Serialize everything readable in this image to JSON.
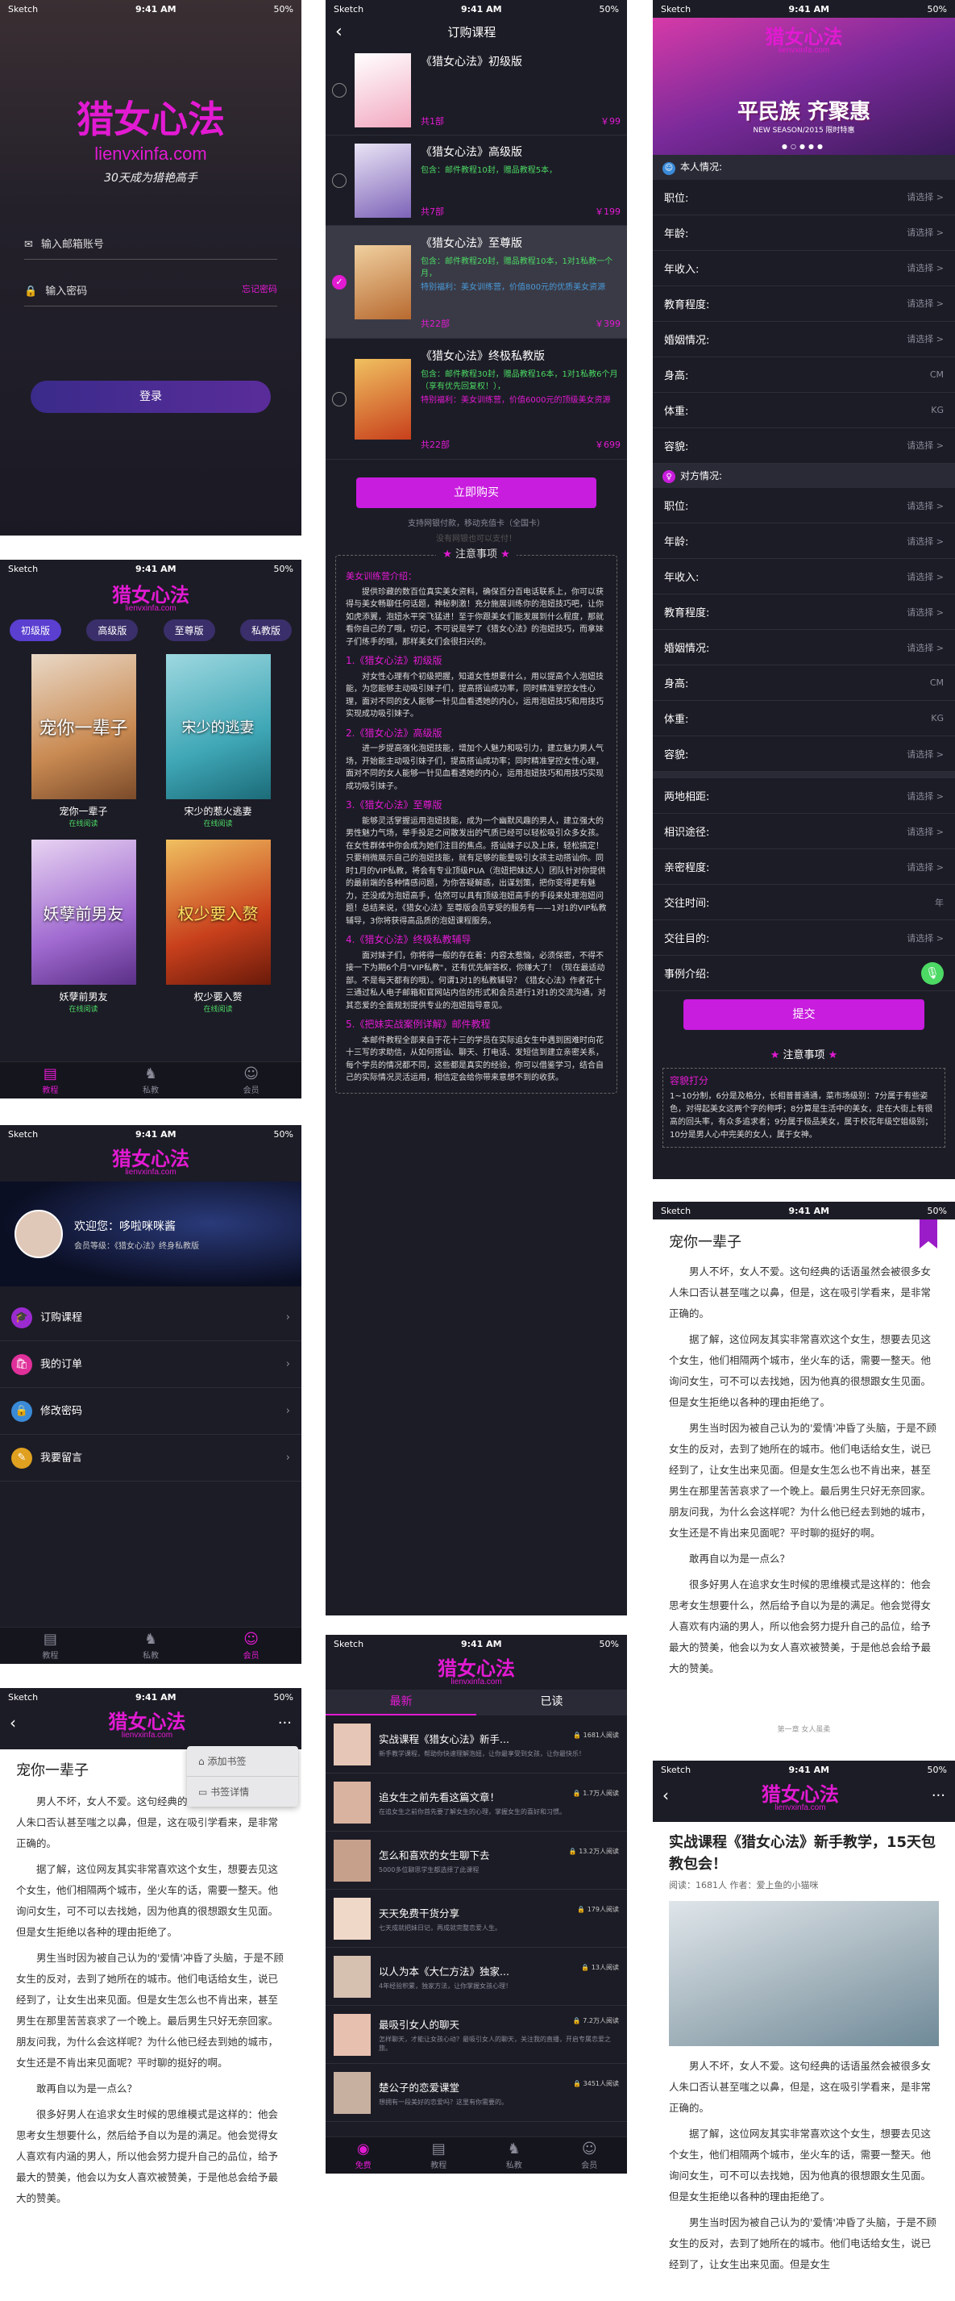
{
  "status": {
    "carrier": "Sketch",
    "time": "9:41 AM",
    "battery": "50%"
  },
  "brand": {
    "name": "猎女心法",
    "domain": "lienvxinfa.com",
    "slogan": "30天成为猎艳高手"
  },
  "login": {
    "email_ph": "输入邮箱账号",
    "pwd_ph": "输入密码",
    "forgot": "忘记密码",
    "submit": "登录"
  },
  "shelf": {
    "tabs": [
      "初级版",
      "高级版",
      "至尊版",
      "私教版"
    ],
    "books": [
      {
        "cover": "宠你一辈子",
        "title": "宠你一辈子",
        "status": "在线阅读"
      },
      {
        "cover": "宋少的逃妻",
        "title": "宋少的惹火逃妻",
        "status": "在线阅读"
      },
      {
        "cover": "妖孽前男友",
        "title": "妖孽前男友",
        "status": "在线阅读"
      },
      {
        "cover": "权少要入赘",
        "title": "权少要入赘",
        "status": "在线阅读"
      }
    ]
  },
  "nav": {
    "tutorial": "教程",
    "private": "私教",
    "member": "会员",
    "free": "免费"
  },
  "profile": {
    "welcome": "欢迎您：哆啦咪咪酱",
    "level": "会员等级：《猎女心法》终身私教版",
    "menu": [
      "订购课程",
      "我的订单",
      "修改密码",
      "我要留言"
    ]
  },
  "order": {
    "title": "订购课程",
    "items": [
      {
        "name": "《猎女心法》初级版",
        "desc": "",
        "extra": "",
        "count": "共1部",
        "price": "￥99"
      },
      {
        "name": "《猎女心法》高级版",
        "desc": "包含：邮件教程10封，赠品教程5本，",
        "extra": "",
        "count": "共7部",
        "price": "￥199"
      },
      {
        "name": "《猎女心法》至尊版",
        "desc": "包含：邮件教程20封，赠品教程10本，1对1私教一个月，",
        "extra": "特别福利：美女训练营，价值800元的优质美女资源",
        "count": "共22部",
        "price": "￥399"
      },
      {
        "name": "《猎女心法》终极私教版",
        "desc": "包含：邮件教程30封，赠品教程16本，1对1私教6个月（享有优先回复权！），",
        "extra": "特别福利：美女训练营，价值6000元的顶级美女资源",
        "count": "共22部",
        "price": "￥699"
      }
    ],
    "buy": "立即购买",
    "pay1": "支持网银付款，移动充值卡（全国卡）",
    "pay2": "没有网银也可以支付！",
    "notice_title": "注意事项"
  },
  "notice": {
    "s0": "美女训练营介绍：",
    "p0": "提供珍藏的数百位真实美女资料，确保百分百电话联系上，你可以获得与美女畅聊任何话题，神秘刺激！充分施展训练你的泡妞技巧吧，让你如虎添翼，泡妞水平突飞猛进！至于你跟美女们能发展到什么程度，那就看你自己的了哦，切记，不可说是学了《猎女心法》的泡妞技巧，而拿妹子们练手的哦，那样美女们会很扫兴的。",
    "s1": "1.《猎女心法》初级版",
    "p1": "对女性心理有个初级把握，知道女性想要什么，用以提高个人泡妞技能，为您能够主动吸引妹子们，提高搭讪成功率，同时精准掌控女性心理，面对不同的女人能够一针见血看透她的内心，运用泡妞技巧和用技巧实现成功吸引妹子。",
    "s2": "2.《猎女心法》高级版",
    "p2": "进一步提高强化泡妞技能，增加个人魅力和吸引力，建立魅力男人气场，开始能主动吸引妹子们，提高搭讪成功率；同时精准掌控女性心理，面对不同的女人能够一针见血看透她的内心，运用泡妞技巧和用技巧实现成功吸引妹子。",
    "s3": "3.《猎女心法》至尊版",
    "p3": "能够灵活掌握运用泡妞技能，成为一个幽默风趣的男人，建立强大的男性魅力气场，举手投足之间散发出的气质已经可以轻松吸引众多女孩。在女性群体中你会成为她们注目的焦点。搭讪妹子以及上床，轻松搞定！只要稍微展示自己的泡妞技能，就有足够的能量吸引女孩主动搭讪你。同时1月的VIP私教，将会有专业顶级PUA（泡妞把妹达人）团队针对你提供的最前端的各种情感问题，为你答疑解惑，出谋划策，把你变得更有魅力，还没成为泡妞高手，估然可以具有顶级泡妞高手的手段来处理泡妞问题！总结来说，《猎女心法》至尊版会员享受的服务有——1对1的VIP私教辅导，3你将获得高品质的泡妞课程服务。",
    "s4": "4.《猎女心法》终极私教辅导",
    "p4": "面对妹子们，你将得一般的存在着：内容太惹恼，必须保密，不得不接一下为期6个月\"VIP私教\"，还有优先解答权，你赚大了！（现在最适动部。不是每天都有的哦）。何谓1对1的私教辅导？《猎女心法》作者花十三通过私人电子邮箱和官网站内信的形式和会员进行1对1的交流沟通，对其恋爱的全面规划提供专业的泡妞指导意见。",
    "s5": "5.《把妹实战案例详解》邮件教程",
    "p5": "本邮件教程全部来自于花十三的学员在实际追女生中遇到困难时向花十三写的求助信，从如何搭讪、聊天、打电话、发短信到建立亲密关系，每个学员的情况都不同，这些都是真实的经验，你可以借鉴学习，结合自己的实际情况灵活运用，相信定会给你带来意想不到的收获。"
  },
  "questionnaire": {
    "banner_big": "平民族 齐聚惠",
    "banner_small": "NEW SEASON/2015 限时特惠",
    "section1": "本人情况:",
    "section2": "对方情况:",
    "self_fields": [
      {
        "label": "职位:",
        "value": "请选择 >"
      },
      {
        "label": "年龄:",
        "value": "请选择 >"
      },
      {
        "label": "年收入:",
        "value": "请选择 >"
      },
      {
        "label": "教育程度:",
        "value": "请选择 >"
      },
      {
        "label": "婚姻情况:",
        "value": "请选择 >"
      },
      {
        "label": "身高:",
        "value": "CM"
      },
      {
        "label": "体重:",
        "value": "KG"
      },
      {
        "label": "容貌:",
        "value": "请选择 >"
      }
    ],
    "other_fields": [
      {
        "label": "职位:",
        "value": "请选择 >"
      },
      {
        "label": "年龄:",
        "value": "请选择 >"
      },
      {
        "label": "年收入:",
        "value": "请选择 >"
      },
      {
        "label": "教育程度:",
        "value": "请选择 >"
      },
      {
        "label": "婚姻情况:",
        "value": "请选择 >"
      },
      {
        "label": "身高:",
        "value": "CM"
      },
      {
        "label": "体重:",
        "value": "KG"
      },
      {
        "label": "容貌:",
        "value": "请选择 >"
      }
    ],
    "extra_fields": [
      {
        "label": "两地相距:",
        "value": "请选择 >"
      },
      {
        "label": "相识途径:",
        "value": "请选择 >"
      },
      {
        "label": "亲密程度:",
        "value": "请选择 >"
      },
      {
        "label": "交往时间:",
        "value": "年"
      },
      {
        "label": "交往目的:",
        "value": "请选择 >"
      }
    ],
    "example": "事例介绍:",
    "submit": "提交",
    "notice_title": "注意事项",
    "notice_tag": "容貌打分",
    "notice_text": "1~10分制，6分是及格分，长相普普通通，菜市场级别：7分属于有些姿色，对得起美女这两个字的称呼；8分算是生活中的美女，走在大街上有很高的回头率，有众多追求者；9分属于极品美女，属于校花年级空姐级别；10分是男人心中完美的女人，属于女神。"
  },
  "reader": {
    "title": "宠你一辈子",
    "footer": "第一章 女人虽柔",
    "paras": [
      "男人不坏，女人不爱。这句经典的话语虽然会被很多女人朱口否认甚至嗤之以鼻，但是，这在吸引学看来，是非常正确的。",
      "据了解，这位网友其实非常喜欢这个女生，想要去见这个女生，他们相隔两个城市，坐火车的话，需要一整天。他询问女生，可不可以去找她，因为他真的很想跟女生见面。但是女生拒绝以各种的理由拒绝了。",
      "男生当时因为被自己认为的'爱情'冲昏了头脑，于是不顾女生的反对，去到了她所在的城市。他们电话给女生，说已经到了，让女生出来见面。但是女生怎么也不肯出来，甚至男生在那里苦苦哀求了一个晚上。最后男生只好无奈回家。朋友问我，为什么会这样呢？为什么他已经去到她的城市，女生还是不肯出来见面呢？平时聊的挺好的啊。",
      "敢再自以为是一点么？",
      "很多好男人在追求女生时候的思维模式是这样的：他会思考女生想要什么，然后给予自以为是的满足。他会觉得女人喜欢有内涵的男人，所以他会努力提升自己的品位，给予最大的赞美，他会以为女人喜欢被赞美，于是他总会给予最大的赞美。"
    ]
  },
  "reader2": {
    "bookmark": "添加书签",
    "detail": "书签详情"
  },
  "list": {
    "tabs": [
      "最新",
      "已读"
    ],
    "items": [
      {
        "title": "实战课程《猎女心法》新手...",
        "desc": "新手教学课程，帮助你快速理解泡妞，让你最享受到女孩，让你最快乐！",
        "reads": "1681人阅读"
      },
      {
        "title": "追女生之前先看这篇文章！",
        "desc": "在追女生之前你首先要了解女生的心理，掌握女生的喜好和习惯。",
        "reads": "1.7万人阅读"
      },
      {
        "title": "怎么和喜欢的女生聊下去",
        "desc": "5000多位聊思学生都选择了此课程",
        "reads": "13.2万人阅读"
      },
      {
        "title": "天天免费干货分享",
        "desc": "七天成就把妹日记，再成就完整恋爱人生。",
        "reads": "179人阅读"
      },
      {
        "title": "以人为本《大仁方法》独家...",
        "desc": "4年经验积累，独家方法，让你掌握女孩心理！",
        "reads": "13人阅读"
      },
      {
        "title": "最吸引女人的聊天",
        "desc": "怎样聊天，才能让女孩心动？最吸引女人的聊天，关注我的直播，开启专属恋爱之旅。",
        "reads": "7.2万人阅读"
      },
      {
        "title": "楚公子的恋爱课堂",
        "desc": "想拥有一段美好的恋爱吗？这里有你需要的。",
        "reads": "3451人阅读"
      }
    ]
  },
  "article": {
    "title": "实战课程《猎女心法》新手教学，15天包教包会！",
    "meta": "阅读：1681人  作者：爱上鱼的小猫咪",
    "paras": [
      "男人不坏，女人不爱。这句经典的话语虽然会被很多女人朱口否认甚至嗤之以鼻，但是，这在吸引学看来，是非常正确的。",
      "据了解，这位网友其实非常喜欢这个女生，想要去见这个女生，他们相隔两个城市，坐火车的话，需要一整天。他询问女生，可不可以去找她，因为他真的很想跟女生见面。但是女生拒绝以各种的理由拒绝了。",
      "男生当时因为被自己认为的'爱情'冲昏了头脑，于是不顾女生的反对，去到了她所在的城市。他们电话给女生，说已经到了，让女生出来见面。但是女生"
    ]
  }
}
